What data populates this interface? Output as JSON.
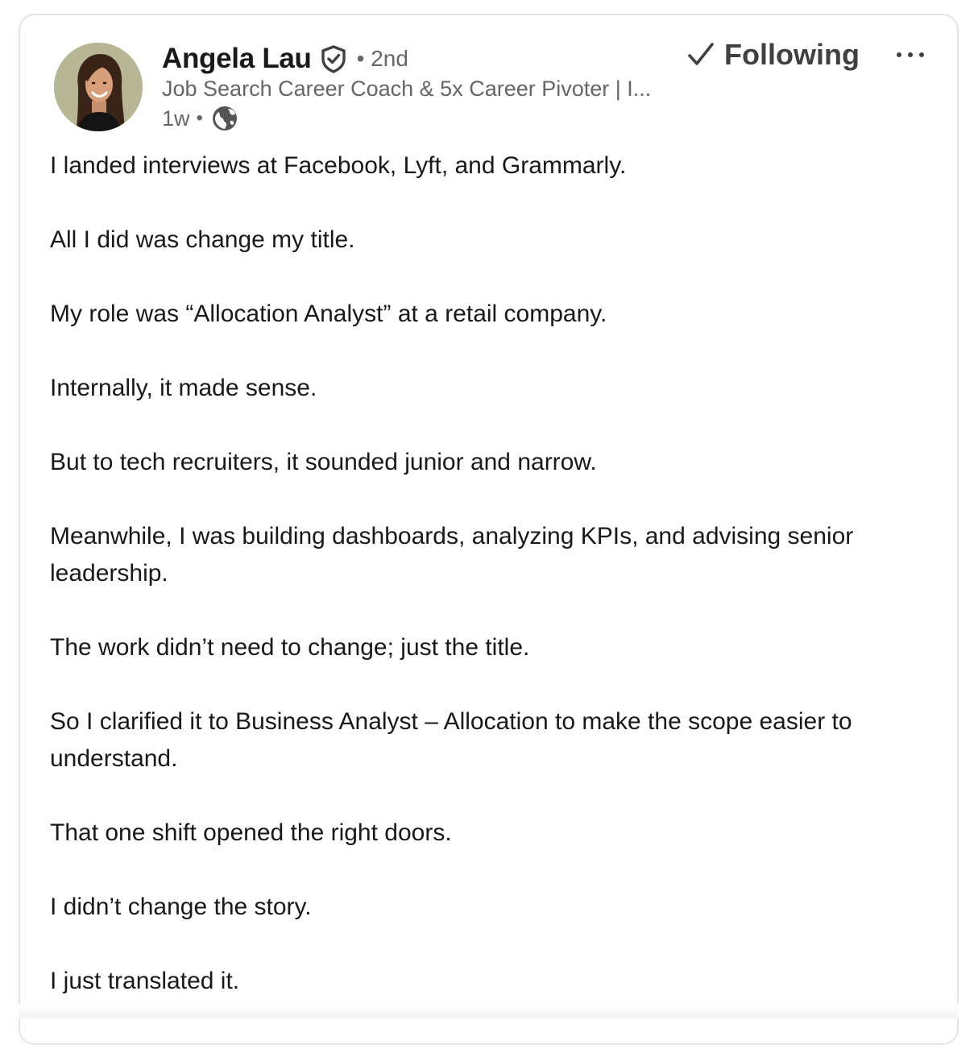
{
  "post": {
    "author": {
      "name": "Angela Lau",
      "degree": "• 2nd",
      "headline": "Job Search Career Coach & 5x Career Pivoter | I...",
      "timestamp": "1w",
      "separator": "•",
      "verified_icon": "verified-shield-icon",
      "visibility_icon": "globe-icon"
    },
    "actions": {
      "following_label": "Following",
      "following_icon": "checkmark-icon",
      "more_icon": "ellipsis-icon"
    },
    "body": [
      "I landed interviews at Facebook, Lyft, and Grammarly.",
      "All I did was change my title.",
      "My role was “Allocation Analyst” at a retail company.",
      "Internally, it made sense.",
      "But to tech recruiters, it sounded junior and narrow.",
      "Meanwhile, I was building dashboards, analyzing KPIs, and advising senior leadership.",
      "The work didn’t need to change; just the title.",
      "So I clarified it to Business Analyst – Allocation to make the scope easier to understand.",
      "That one shift opened the right doors.",
      "I didn’t change the story.",
      "I just translated it."
    ]
  },
  "colors": {
    "text_primary": "#191919",
    "text_secondary": "#666666",
    "border": "#e4e4e4",
    "avatar_bg": "#b9b99a"
  }
}
